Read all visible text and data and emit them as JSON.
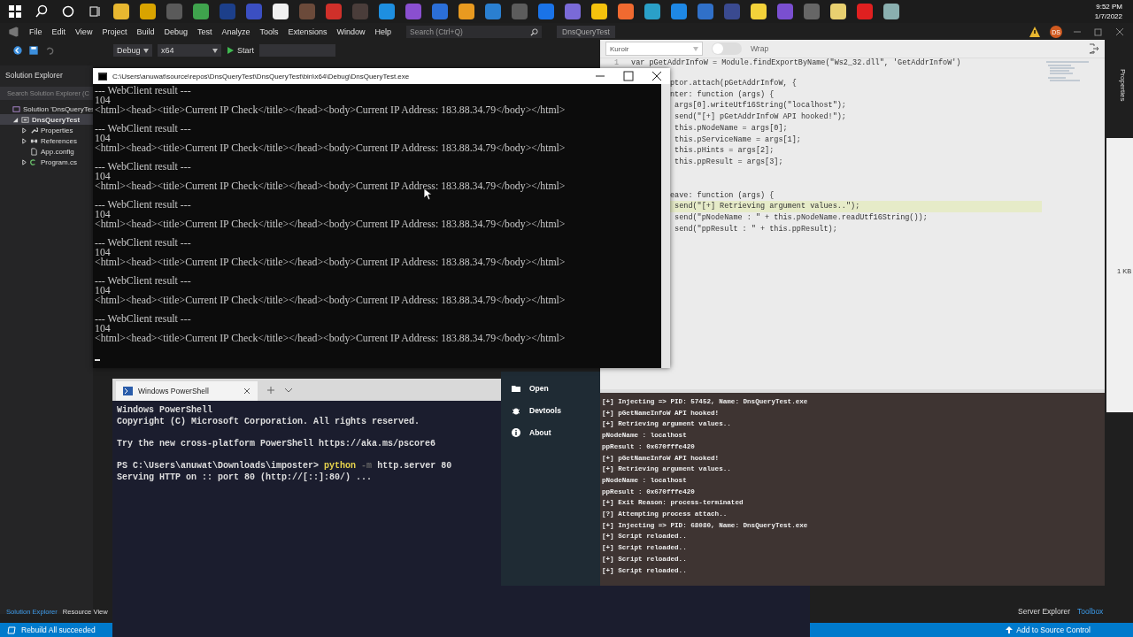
{
  "taskbar": {
    "time": "9:52 PM",
    "date": "1/7/2022"
  },
  "vs": {
    "menu": [
      "File",
      "Edit",
      "View",
      "Project",
      "Build",
      "Debug",
      "Test",
      "Analyze",
      "Tools",
      "Extensions",
      "Window",
      "Help"
    ],
    "search": {
      "placeholder": "Search (Ctrl+Q)"
    },
    "title": "DnsQueryTest",
    "account": "DS",
    "toolbar": {
      "configuration": "Debug",
      "platform": "x64",
      "start": "Start"
    },
    "solution_explorer": {
      "title": "Solution Explorer",
      "search": {
        "placeholder": "Search Solution Explorer (C"
      },
      "tree": [
        {
          "label": "Solution 'DnsQueryTes",
          "kind": "solution",
          "expandable": false,
          "selected": false,
          "children": [
            {
              "label": "DnsQueryTest",
              "kind": "project",
              "expandable": true,
              "expanded": true,
              "selected": true,
              "children": [
                {
                  "label": "Properties",
                  "kind": "properties",
                  "expandable": true,
                  "expanded": false,
                  "selected": false
                },
                {
                  "label": "References",
                  "kind": "references",
                  "expandable": true,
                  "expanded": false,
                  "selected": false
                },
                {
                  "label": "App.config",
                  "kind": "config",
                  "expandable": false,
                  "selected": false
                },
                {
                  "label": "Program.cs",
                  "kind": "csharp",
                  "expandable": true,
                  "expanded": false,
                  "selected": false
                }
              ]
            }
          ]
        }
      ]
    },
    "left_tabs": [
      {
        "label": "Solution Explorer",
        "selected": true
      },
      {
        "label": "Resource View",
        "selected": false
      }
    ],
    "right_tabs": [
      {
        "label": "Server Explorer",
        "selected": false
      },
      {
        "label": "Toolbox",
        "selected": true
      }
    ],
    "properties_tab": "Properties",
    "file_size": "1 KB",
    "status": {
      "message": "Rebuild All succeeded",
      "source_control": "Add to Source Control"
    }
  },
  "console": {
    "title": "C:\\Users\\anuwat\\source\\repos\\DnsQueryTest\\DnsQueryTest\\bin\\x64\\Debug\\DnsQueryTest.exe",
    "results": [
      {
        "header": "--- WebClient result ---",
        "status": "104",
        "body": "<html><head><title>Current IP Check</title></head><body>Current IP Address: 183.88.34.79</body></html>"
      },
      {
        "header": "--- WebClient result ---",
        "status": "104",
        "body": "<html><head><title>Current IP Check</title></head><body>Current IP Address: 183.88.34.79</body></html>"
      },
      {
        "header": "--- WebClient result ---",
        "status": "104",
        "body": "<html><head><title>Current IP Check</title></head><body>Current IP Address: 183.88.34.79</body></html>"
      },
      {
        "header": "--- WebClient result ---",
        "status": "104",
        "body": "<html><head><title>Current IP Check</title></head><body>Current IP Address: 183.88.34.79</body></html>"
      },
      {
        "header": "--- WebClient result ---",
        "status": "104",
        "body": "<html><head><title>Current IP Check</title></head><body>Current IP Address: 183.88.34.79</body></html>"
      },
      {
        "header": "--- WebClient result ---",
        "status": "104",
        "body": "<html><head><title>Current IP Check</title></head><body>Current IP Address: 183.88.34.79</body></html>"
      },
      {
        "header": "--- WebClient result ---",
        "status": "104",
        "body": "<html><head><title>Current IP Check</title></head><body>Current IP Address: 183.88.34.79</body></html>"
      }
    ]
  },
  "powershell": {
    "tab": "Windows PowerShell",
    "banner": [
      "Windows PowerShell",
      "Copyright (C) Microsoft Corporation. All rights reserved."
    ],
    "hint": "Try the new cross-platform PowerShell https://aka.ms/pscore6",
    "prompt": {
      "path": "PS C:\\Users\\anuwat\\Downloads\\imposter>",
      "command": "python",
      "flag": "-m",
      "args": "http.server 80"
    },
    "output": "Serving HTTP on :: port 80 (http://[::]:80/) ..."
  },
  "frida": {
    "theme": "Kuroir",
    "wrap": {
      "label": "Wrap",
      "on": false
    },
    "first_line": {
      "number": "1",
      "text": "var pGetAddrInfoW = Module.findExportByName(\"Ws2_32.dll\", 'GetAddrInfoW')"
    },
    "on_enter": [
      {
        "text": "ptor.attach(pGetAddrInfoW, {",
        "highlighted": false
      },
      {
        "text": "nter: function (args) {",
        "highlighted": false
      },
      {
        "text": " args[0].writeUtf16String(\"localhost\");",
        "highlighted": false
      },
      {
        "text": " send(\"[+] pGetAddrInfoW API hooked!\");",
        "highlighted": false
      },
      {
        "text": " this.pNodeName = args[0];",
        "highlighted": false
      },
      {
        "text": " this.pServiceName = args[1];",
        "highlighted": false
      },
      {
        "text": " this.pHints = args[2];",
        "highlighted": false
      },
      {
        "text": " this.ppResult = args[3];",
        "highlighted": false
      }
    ],
    "on_leave": [
      {
        "text": "eave: function (args) {",
        "highlighted": false
      },
      {
        "text": " send(\"[+] Retrieving argument values..\");",
        "highlighted": true
      },
      {
        "text": " send(\"pNodeName : \" + this.pNodeName.readUtf16String());",
        "highlighted": false
      },
      {
        "text": " send(\"ppResult : \" + this.ppResult);",
        "highlighted": false
      }
    ],
    "menu": [
      {
        "label": "Open",
        "kind": "open"
      },
      {
        "label": "Devtools",
        "kind": "devtools"
      },
      {
        "label": "About",
        "kind": "about"
      }
    ],
    "log": [
      "[+] Injecting => PID: 57452, Name: DnsQueryTest.exe",
      "[+] pGetNameInfoW API hooked!",
      "[+] Retrieving argument values..",
      "pNodeName : localhost",
      "ppResult : 0x670fffe420",
      "[+] pGetNameInfoW API hooked!",
      "[+] Retrieving argument values..",
      "pNodeName : localhost",
      "ppResult : 0x670fffe420",
      "[+] Exit Reason: process-terminated",
      "[?] Attempting process attach..",
      "[+] Injecting => PID: 68080, Name: DnsQueryTest.exe",
      "[+] Script reloaded..",
      "[+] Script reloaded..",
      "[+] Script reloaded..",
      "[+] Script reloaded.."
    ]
  }
}
